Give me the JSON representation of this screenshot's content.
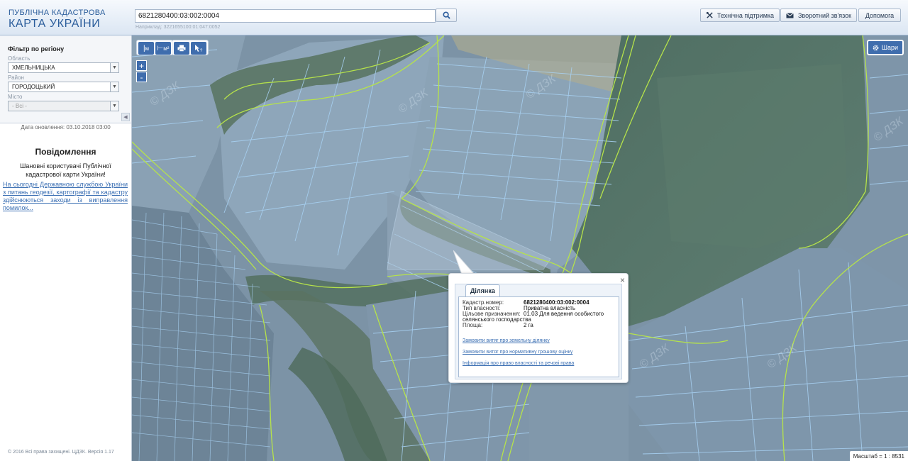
{
  "header": {
    "brand_small": "ПУБЛІЧНА КАДАСТРОВА",
    "brand_big": "КАРТА УКРАЇНИ",
    "search_value": "6821280400:03:002:0004",
    "search_hint": "Наприклад: 3221655100:01:047:0052",
    "buttons": {
      "support": "Технічна підтримка",
      "feedback": "Зворотний зв'язок",
      "help": "Допомога"
    }
  },
  "sidebar": {
    "filter_title": "Фільтр по регіону",
    "oblast_label": "Область",
    "oblast_value": "ХМЕЛЬНИЦЬКА",
    "rayon_label": "Район",
    "rayon_value": "ГОРОДОЦЬКИЙ",
    "city_label": "Місто",
    "city_value": "- Всі -",
    "update_date": "Дата оновлення: 03.10.2018 03:00",
    "notice_title": "Повідомлення",
    "notice_body": "Шановні користувачі Публічної кадастрової карти України!",
    "notice_link": "На сьогодні Державною службою України з питань геодезії, картографії та кадастру здійснюються заходи із виправлення помилок...",
    "copyright": "© 2016 Всі права захищені. ЦДЗК. Версія 1.17"
  },
  "map": {
    "tools": {
      "ruler": "м",
      "area": "м²"
    },
    "zoom_in": "+",
    "zoom_out": "-",
    "layers_label": "Шари",
    "scale_text": "Масштаб = 1 : 8531",
    "watermark": "© ДЗК"
  },
  "popup": {
    "tab": "Ділянка",
    "fields": [
      {
        "k": "Кадастр.номер:",
        "v": "6821280400:03:002:0004"
      },
      {
        "k": "Тип власності:",
        "v": "Приватна власність"
      },
      {
        "k": "Цільове призначення:",
        "v": "01.03 Для ведення особистого селянського господарства"
      },
      {
        "k": "Площа:",
        "v": "2 га"
      }
    ],
    "links": [
      "Замовити витяг про земельну ділянку",
      "Замовити витяг про нормативну грошову оцінку",
      "Інформація про право власності та речові права"
    ]
  },
  "colors": {
    "brand": "#2b5d9b",
    "accent": "#3f6dad",
    "parcel_line": "#9ccaf0",
    "boundary_line": "#b6e34a"
  }
}
